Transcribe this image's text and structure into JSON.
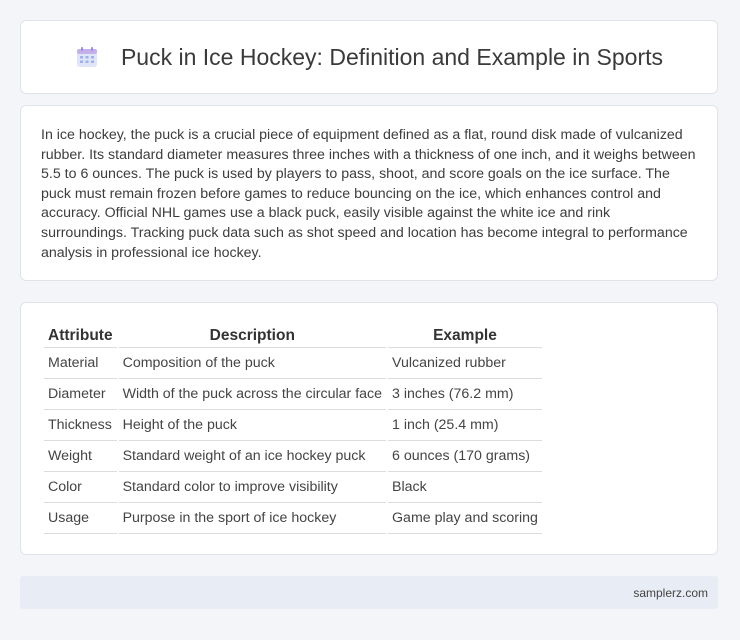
{
  "header": {
    "title": "Puck in Ice Hockey: Definition and Example in Sports",
    "icon": "calendar-icon",
    "icon_colors": {
      "top": "#c9b3ee",
      "body": "#d9e2f8",
      "grid": "#9aa8e8"
    }
  },
  "intro": {
    "text": "In ice hockey, the puck is a crucial piece of equipment defined as a flat, round disk made of vulcanized rubber. Its standard diameter measures three inches with a thickness of one inch, and it weighs between 5.5 to 6 ounces. The puck is used by players to pass, shoot, and score goals on the ice surface. The puck must remain frozen before games to reduce bouncing on the ice, which enhances control and accuracy. Official NHL games use a black puck, easily visible against the white ice and rink surroundings. Tracking puck data such as shot speed and location has become integral to performance analysis in professional ice hockey."
  },
  "table": {
    "headers": [
      "Attribute",
      "Description",
      "Example"
    ],
    "rows": [
      [
        "Material",
        "Composition of the puck",
        "Vulcanized rubber"
      ],
      [
        "Diameter",
        "Width of the puck across the circular face",
        "3 inches (76.2 mm)"
      ],
      [
        "Thickness",
        "Height of the puck",
        "1 inch (25.4 mm)"
      ],
      [
        "Weight",
        "Standard weight of an ice hockey puck",
        "6 ounces (170 grams)"
      ],
      [
        "Color",
        "Standard color to improve visibility",
        "Black"
      ],
      [
        "Usage",
        "Purpose in the sport of ice hockey",
        "Game play and scoring"
      ]
    ]
  },
  "footer": {
    "text": "samplerz.com"
  }
}
